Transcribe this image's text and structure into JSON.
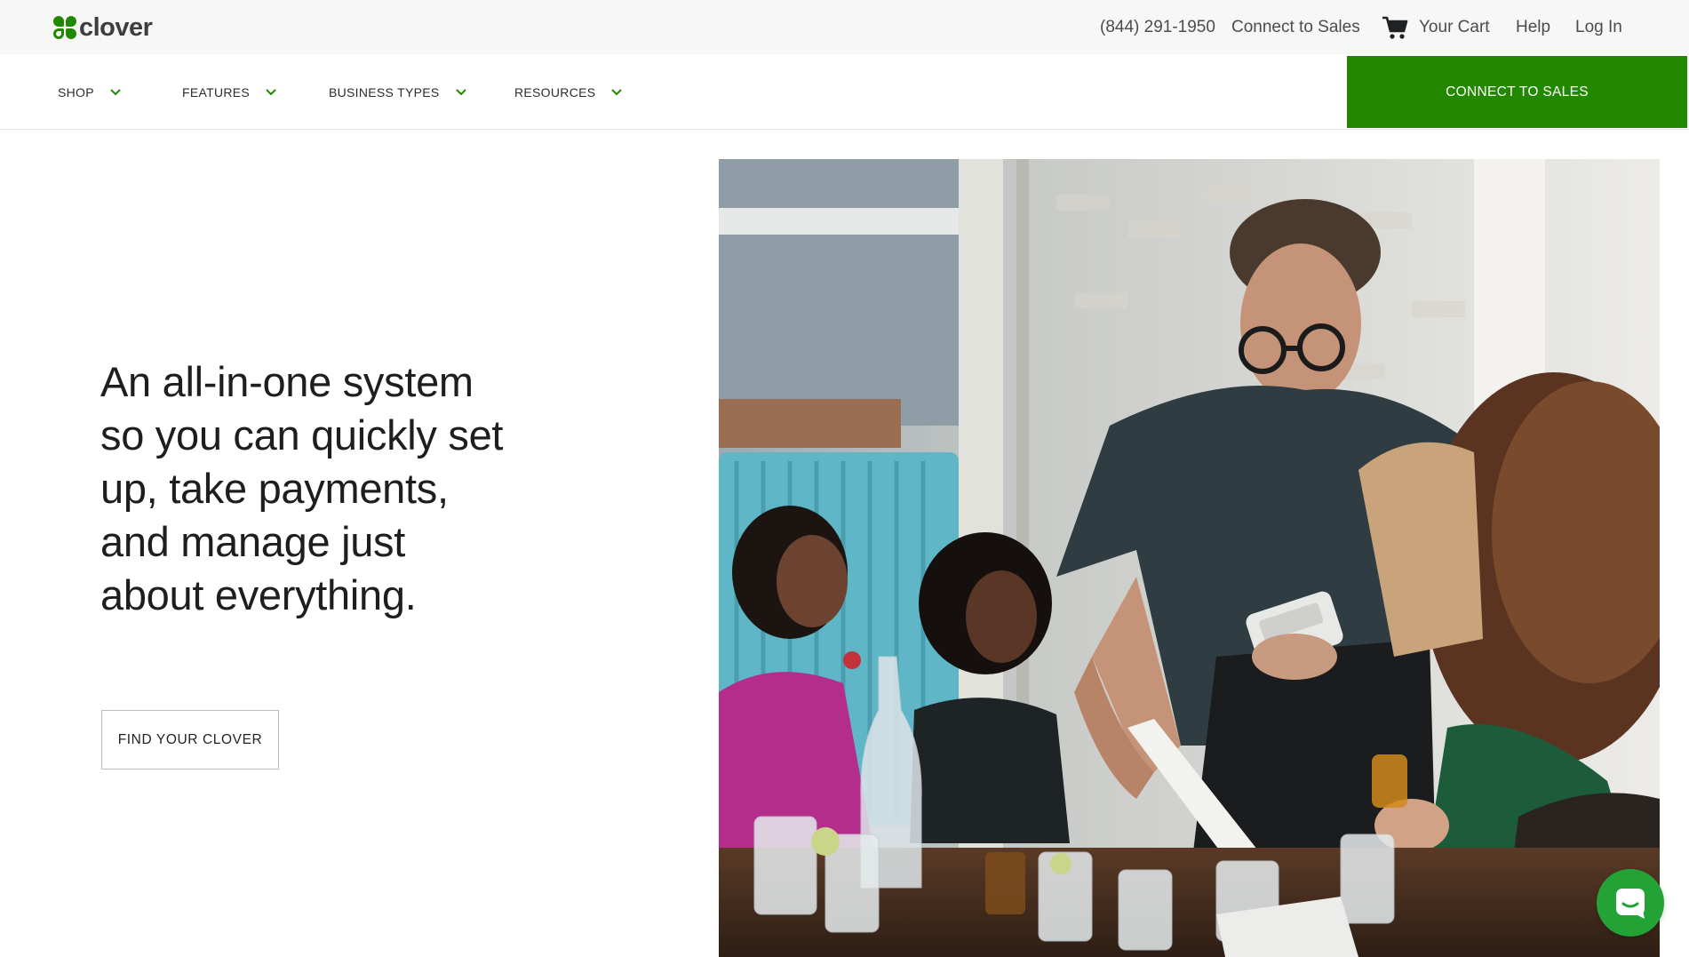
{
  "brand": {
    "name": "clover",
    "color": "#228800"
  },
  "utility_bar": {
    "phone": "(844) 291-1950",
    "connect_label": "Connect to Sales",
    "cart_label": "Your Cart",
    "cart_icon": "shopping-cart-icon",
    "help_label": "Help",
    "login_label": "Log In"
  },
  "nav": {
    "items": [
      {
        "label": "SHOP"
      },
      {
        "label": "FEATURES"
      },
      {
        "label": "BUSINESS TYPES"
      },
      {
        "label": "RESOURCES"
      }
    ],
    "cta_label": "CONNECT TO SALES"
  },
  "hero": {
    "headline": "An all-in-one system so you can quickly set up, take payments, and manage just about everything.",
    "button_label": "FIND YOUR CLOVER"
  },
  "chat": {
    "icon": "chat-icon"
  }
}
